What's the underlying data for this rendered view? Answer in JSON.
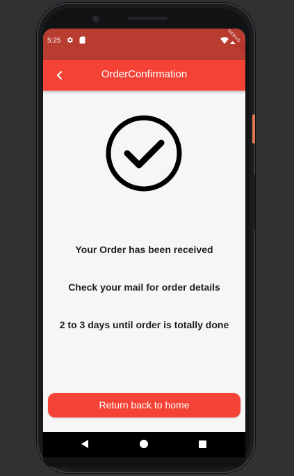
{
  "status_bar": {
    "time": "5:25",
    "icons": [
      "gear-icon",
      "sd-card-icon",
      "wifi-icon",
      "signal-icon",
      "battery-icon"
    ]
  },
  "debug_banner": "DEBUG",
  "app_bar": {
    "title": "OrderConfirmation",
    "back_icon": "chevron-left-icon"
  },
  "confirmation": {
    "icon": "check-circle-icon",
    "messages": [
      "Your Order has been received",
      "Check your mail for order details",
      "2 to 3 days until order is totally done"
    ]
  },
  "home_button": {
    "label": "Return back to home"
  },
  "nav_bar": {
    "icons": [
      "nav-back-icon",
      "nav-home-icon",
      "nav-recent-icon"
    ]
  },
  "colors": {
    "status_bar": "#b93c31",
    "app_bar": "#f44336",
    "button": "#f44336",
    "background": "#f6f6f6",
    "text": "#1e1e1e"
  }
}
